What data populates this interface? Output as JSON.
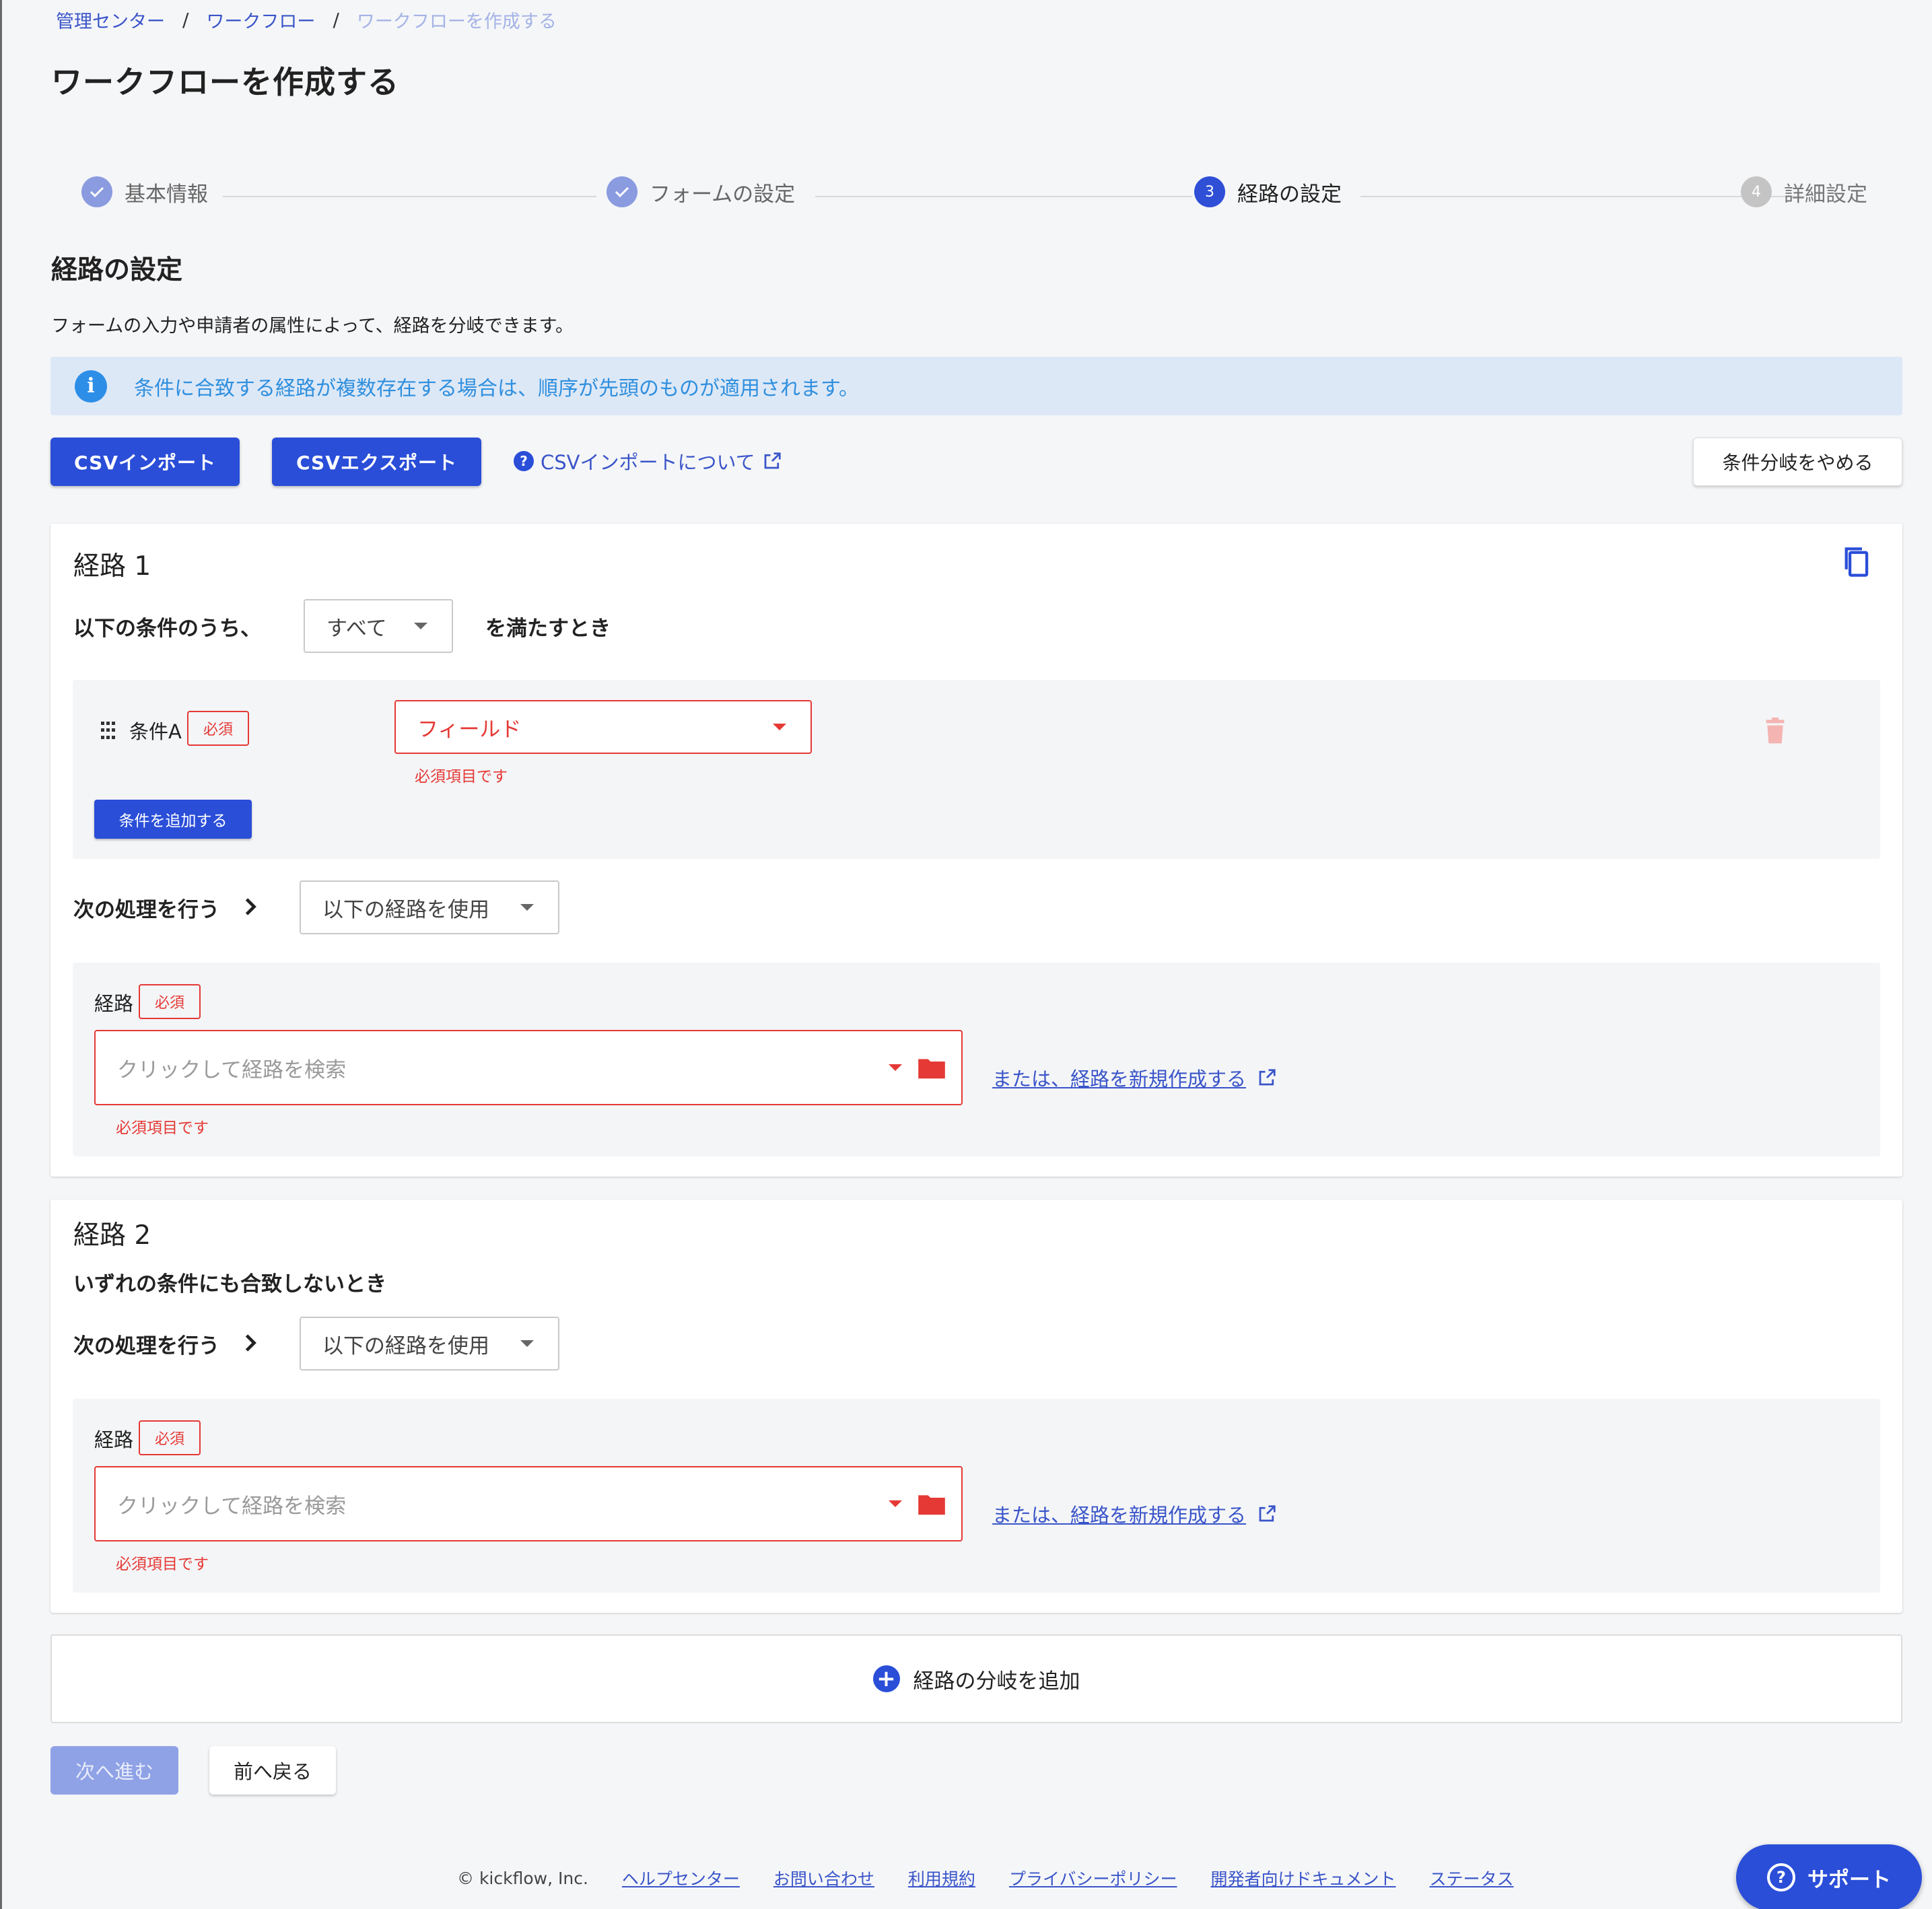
{
  "breadcrumb": {
    "items": [
      "管理センター",
      "ワークフロー"
    ],
    "current": "ワークフローを作成する",
    "separator": "/"
  },
  "page_title": "ワークフローを作成する",
  "stepper": {
    "steps": [
      {
        "label": "基本情報",
        "state": "done",
        "number": ""
      },
      {
        "label": "フォームの設定",
        "state": "done",
        "number": ""
      },
      {
        "label": "経路の設定",
        "state": "active",
        "number": "3"
      },
      {
        "label": "詳細設定",
        "state": "pending",
        "number": "4"
      }
    ]
  },
  "section": {
    "title": "経路の設定",
    "description": "フォームの入力や申請者の属性によって、経路を分岐できます。"
  },
  "info_banner": {
    "icon": "i",
    "text": "条件に合致する経路が複数存在する場合は、順序が先頭のものが適用されます。"
  },
  "toolbar": {
    "csv_import": "CSVインポート",
    "csv_export": "CSVエクスポート",
    "help_icon": "?",
    "help_link": "CSVインポートについて",
    "stop_branch": "条件分岐をやめる"
  },
  "route1": {
    "title": "経路 1",
    "condition_prefix": "以下の条件のうち、",
    "match_select": "すべて",
    "condition_suffix": "を満たすとき",
    "condition": {
      "label": "条件A",
      "required": "必須",
      "field_placeholder": "フィールド",
      "error": "必須項目です"
    },
    "add_condition": "条件を追加する",
    "next_action_label": "次の処理を行う",
    "next_action_select": "以下の経路を使用",
    "route_label": "経路",
    "route_required": "必須",
    "route_placeholder": "クリックして経路を検索",
    "route_error": "必須項目です",
    "new_route_link": "または、経路を新規作成する"
  },
  "route2": {
    "title": "経路 2",
    "no_match_text": "いずれの条件にも合致しないとき",
    "next_action_label": "次の処理を行う",
    "next_action_select": "以下の経路を使用",
    "route_label": "経路",
    "route_required": "必須",
    "route_placeholder": "クリックして経路を検索",
    "route_error": "必須項目です",
    "new_route_link": "または、経路を新規作成する"
  },
  "add_branch": {
    "icon": "+",
    "label": "経路の分岐を追加"
  },
  "actions": {
    "next": "次へ進む",
    "back": "前へ戻る"
  },
  "footer": {
    "copyright": "© kickflow, Inc.",
    "links": [
      "ヘルプセンター",
      "お問い合わせ",
      "利用規約",
      "プライバシーポリシー",
      "開発者向けドキュメント",
      "ステータス"
    ]
  },
  "support": {
    "icon": "?",
    "label": "サポート"
  },
  "colors": {
    "primary": "#2a4ed8",
    "error": "#e53935",
    "link": "#3a55c9",
    "info_bg": "#dde8f7",
    "info_text": "#2f8fde"
  }
}
